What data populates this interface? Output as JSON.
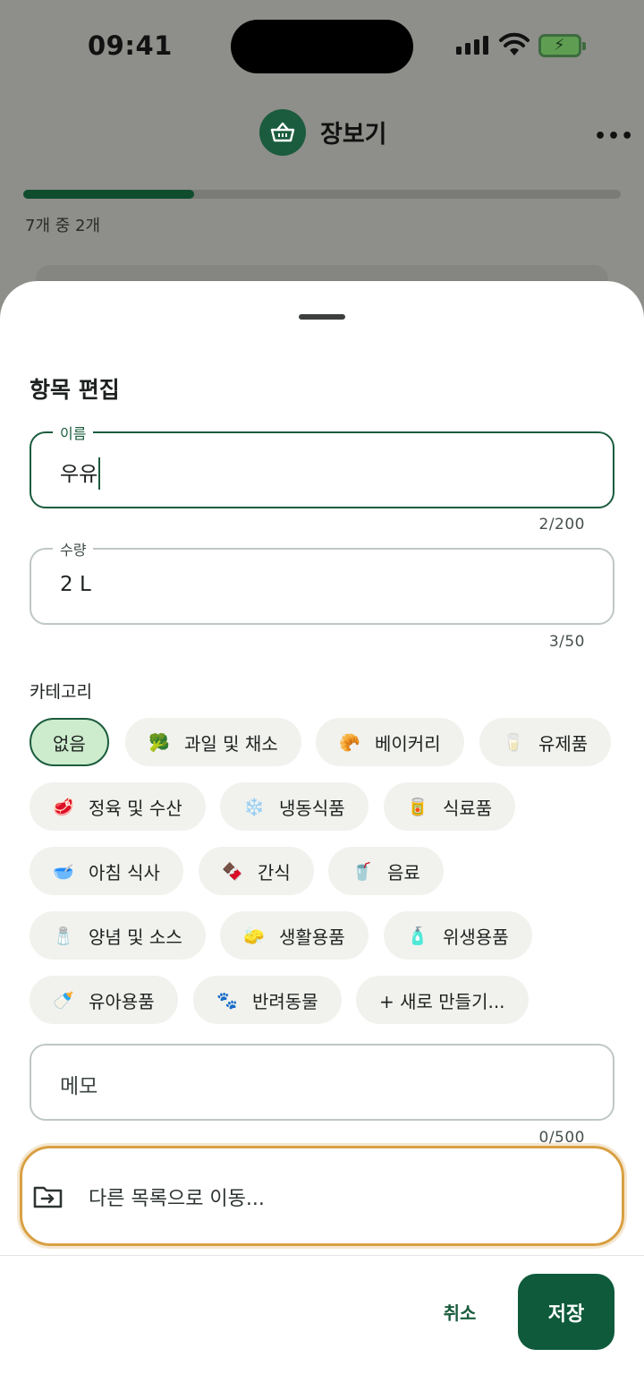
{
  "status_bar": {
    "time": "09:41"
  },
  "app": {
    "title": "장보기",
    "progress_text": "7개 중 2개",
    "progress_value": 0.2857
  },
  "sheet": {
    "title": "항목 편집",
    "name_field": {
      "label": "이름",
      "value": "우유",
      "counter": "2/200"
    },
    "quantity_field": {
      "label": "수량",
      "value": "2 L",
      "counter": "3/50"
    },
    "category_label": "카테고리",
    "categories": [
      {
        "label": "없음",
        "icon": "",
        "selected": true
      },
      {
        "label": "과일 및 채소",
        "icon": "🥦"
      },
      {
        "label": "베이커리",
        "icon": "🥐"
      },
      {
        "label": "유제품",
        "icon": "🥛"
      },
      {
        "label": "정육 및 수산",
        "icon": "🥩"
      },
      {
        "label": "냉동식품",
        "icon": "❄️"
      },
      {
        "label": "식료품",
        "icon": "🥫"
      },
      {
        "label": "아침 식사",
        "icon": "🥣"
      },
      {
        "label": "간식",
        "icon": "🍫"
      },
      {
        "label": "음료",
        "icon": "🥤"
      },
      {
        "label": "양념 및 소스",
        "icon": "🧂"
      },
      {
        "label": "생활용품",
        "icon": "🧽"
      },
      {
        "label": "위생용품",
        "icon": "🧴"
      },
      {
        "label": "유아용품",
        "icon": "🍼"
      },
      {
        "label": "반려동물",
        "icon": "🐾"
      },
      {
        "label": "+ 새로 만들기...",
        "icon": ""
      }
    ],
    "memo_field": {
      "placeholder": "메모",
      "counter": "0/500"
    },
    "move_label": "다른 목록으로 이동...",
    "cancel_label": "취소",
    "save_label": "저장"
  },
  "colors": {
    "accent": "#1a5c3d",
    "highlight": "#d8a043",
    "chip_bg": "#f1f2ee",
    "chip_selected_bg": "#cdeccd"
  }
}
